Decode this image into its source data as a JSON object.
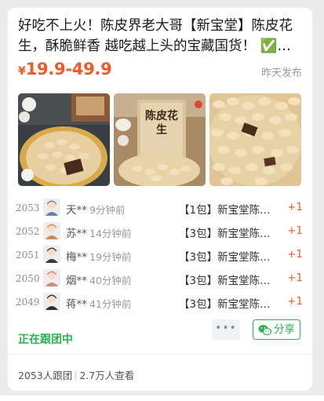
{
  "post": {
    "title": "好吃不上火！陈皮界老大哥【新宝堂】陈皮花生，酥脆鲜香 越吃越上头的宝藏国货！ ✅花…",
    "price_currency": "¥",
    "price_range": "19.9-49.9",
    "posted_time": "昨天发布"
  },
  "photos": [
    {
      "name": "peanut-photo-1"
    },
    {
      "name": "peanut-photo-2",
      "package_text": "陈皮花生"
    },
    {
      "name": "peanut-photo-3"
    }
  ],
  "orders": [
    {
      "num": "2053",
      "user": "天**",
      "time": "9分钟前",
      "item": "【1包】新宝堂陈…",
      "qty": "+1",
      "avatar_color": "#6b7ea8"
    },
    {
      "num": "2052",
      "user": "苏**",
      "time": "14分钟前",
      "item": "【3包】新宝堂陈…",
      "qty": "+1",
      "avatar_color": "#c98b5a"
    },
    {
      "num": "2051",
      "user": "梅**",
      "time": "19分钟前",
      "item": "【3包】新宝堂陈…",
      "qty": "+1",
      "avatar_color": "#3c3c3c"
    },
    {
      "num": "2050",
      "user": "烟**",
      "time": "40分钟前",
      "item": "【3包】新宝堂陈…",
      "qty": "+1",
      "avatar_color": "#d08a7c"
    },
    {
      "num": "2049",
      "user": "蒋**",
      "time": "41分钟前",
      "item": "【3包】新宝堂陈…",
      "qty": "+1",
      "avatar_color": "#2e2e2e"
    }
  ],
  "footer": {
    "status": "正在跟团中",
    "more_label": "•••",
    "share_label": "分享",
    "followers": "2053人跟团",
    "views": "2.7万人查看"
  },
  "colors": {
    "accent_orange": "#f15a24",
    "accent_green": "#2cb24f"
  }
}
